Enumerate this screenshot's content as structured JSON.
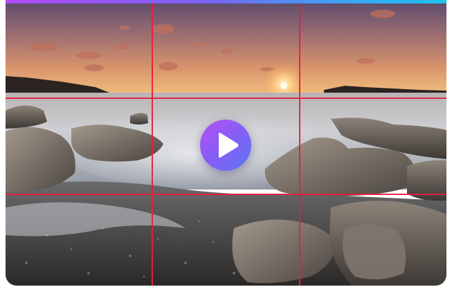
{
  "player": {
    "accent_gradient": [
      "#b04cf5",
      "#7a63f2",
      "#3ea2f4",
      "#1cc2f0"
    ],
    "grid_line_color": "#e81e3c",
    "grid_overlay": "rule-of-thirds",
    "play_button": {
      "icon": "play-icon",
      "gradient": [
        "#b54ff2",
        "#8a5cf5",
        "#5a78f3"
      ]
    }
  }
}
